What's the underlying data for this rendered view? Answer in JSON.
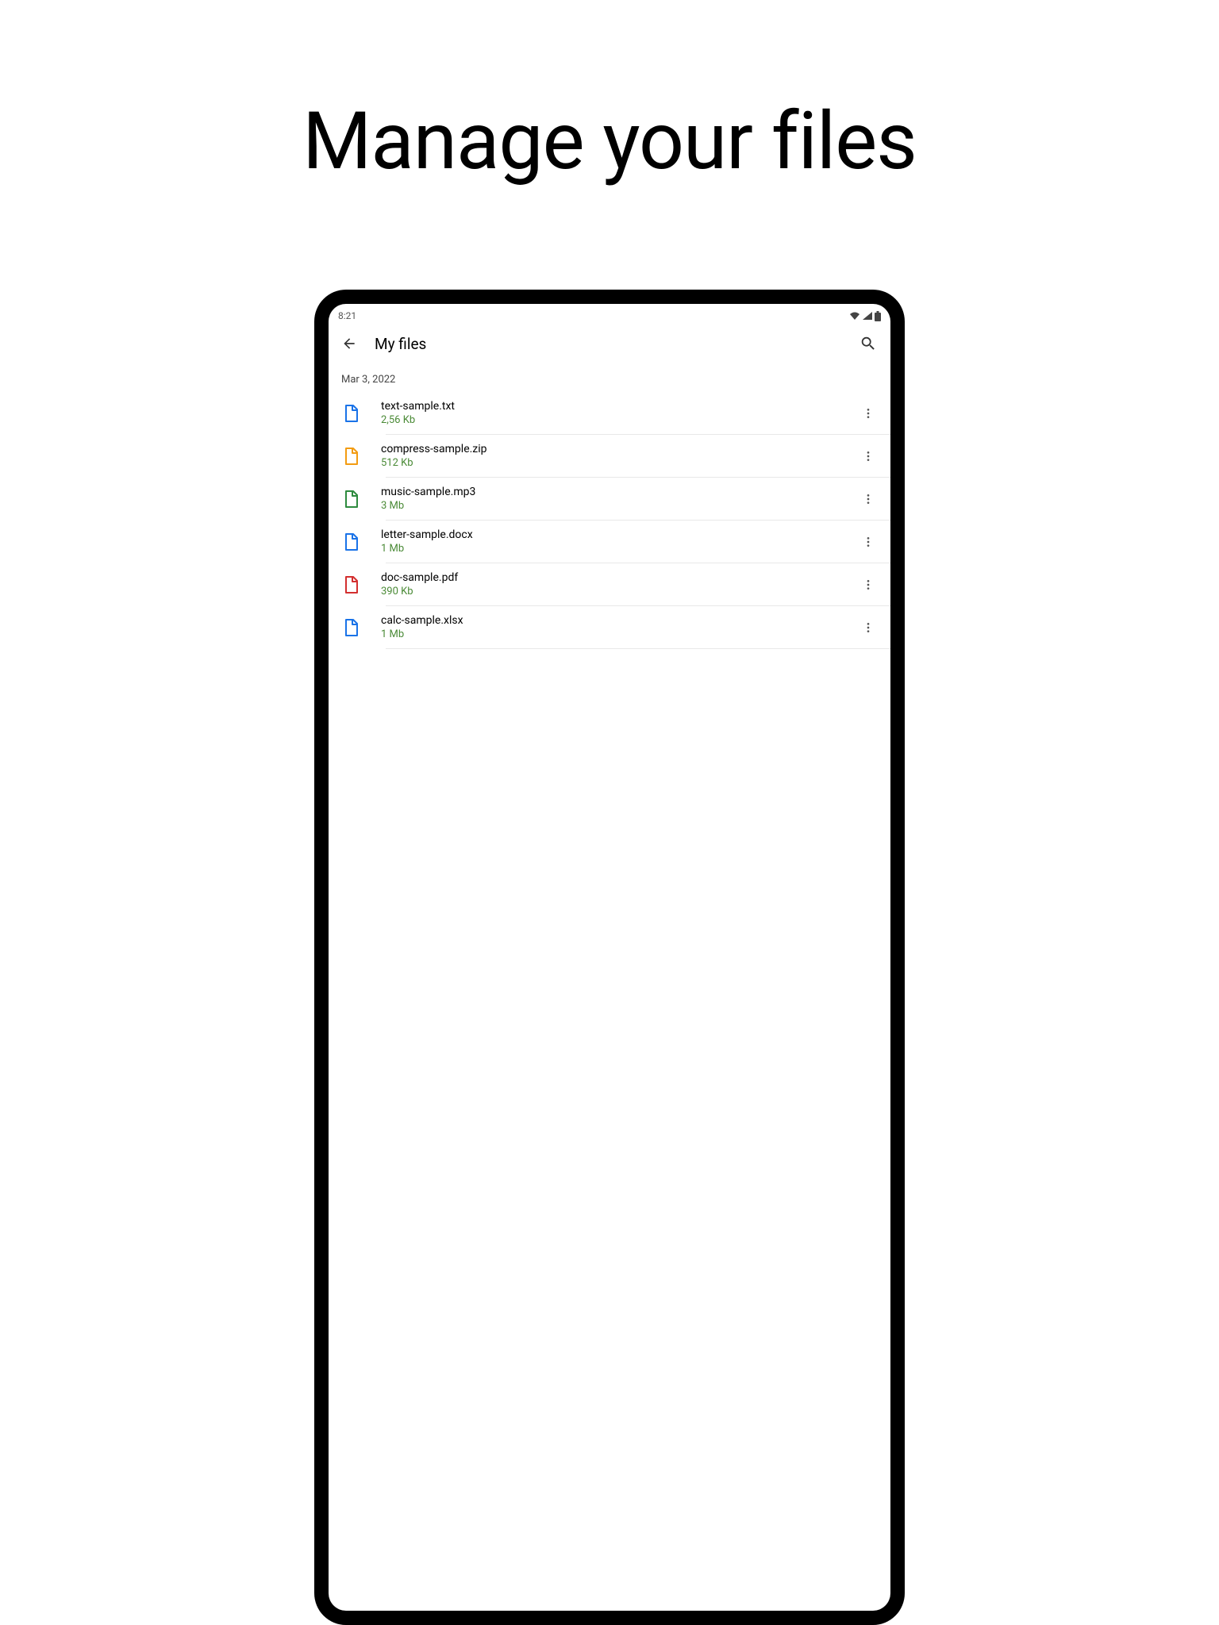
{
  "headline": "Manage your files",
  "status_bar": {
    "time": "8:21"
  },
  "app_bar": {
    "title": "My files"
  },
  "date_header": "Mar 3, 2022",
  "files": [
    {
      "name": "text-sample.txt",
      "size": "2,56 Kb",
      "color": "#1a73e8"
    },
    {
      "name": "compress-sample.zip",
      "size": "512 Kb",
      "color": "#f39c12"
    },
    {
      "name": "music-sample.mp3",
      "size": "3 Mb",
      "color": "#2e8b3f"
    },
    {
      "name": "letter-sample.docx",
      "size": "1 Mb",
      "color": "#1a73e8"
    },
    {
      "name": "doc-sample.pdf",
      "size": "390 Kb",
      "color": "#d32f2f"
    },
    {
      "name": "calc-sample.xlsx",
      "size": "1 Mb",
      "color": "#1a73e8"
    }
  ]
}
